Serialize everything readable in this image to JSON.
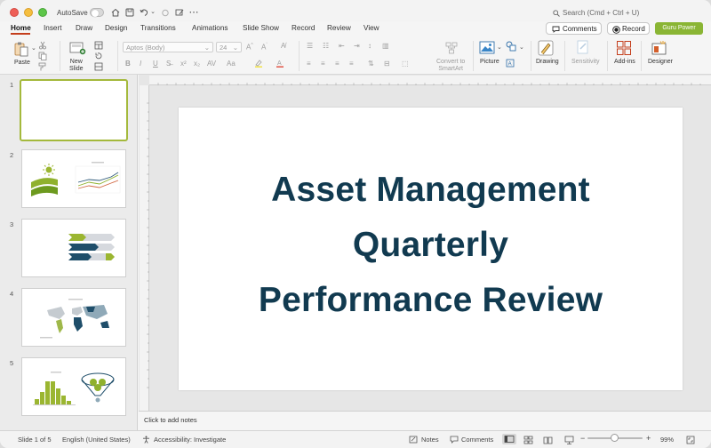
{
  "titlebar": {
    "autosave_label": "AutoSave",
    "search_placeholder": "Search (Cmd + Ctrl + U)"
  },
  "tabs": [
    "Home",
    "Insert",
    "Draw",
    "Design",
    "Transitions",
    "Animations",
    "Slide Show",
    "Record",
    "Review",
    "View"
  ],
  "tab_buttons": {
    "comments": "Comments",
    "record": "Record",
    "guru": "Guru Power"
  },
  "ribbon": {
    "paste": "Paste",
    "new_slide": "New\nSlide",
    "font_name": "Aptos (Body)",
    "font_size": "24",
    "convert_smartart": "Convert to\nSmartArt",
    "picture": "Picture",
    "drawing": "Drawing",
    "sensitivity": "Sensitivity",
    "addins": "Add-ins",
    "designer": "Designer"
  },
  "slides": [
    {
      "number": "1"
    },
    {
      "number": "2"
    },
    {
      "number": "3"
    },
    {
      "number": "4"
    },
    {
      "number": "5"
    }
  ],
  "slide": {
    "title_line1": "Asset Management",
    "title_line2": "Quarterly",
    "title_line3": "Performance Review"
  },
  "notes": {
    "placeholder": "Click to add notes"
  },
  "status": {
    "slide_count": "Slide 1 of 5",
    "language": "English (United States)",
    "accessibility": "Accessibility: Investigate",
    "notes": "Notes",
    "comments": "Comments",
    "zoom": "99%"
  },
  "colors": {
    "accent_tab": "#c43e1c",
    "guru_button": "#8ab534",
    "title_text": "#113a50",
    "thumb_selected": "#a4b93c"
  }
}
